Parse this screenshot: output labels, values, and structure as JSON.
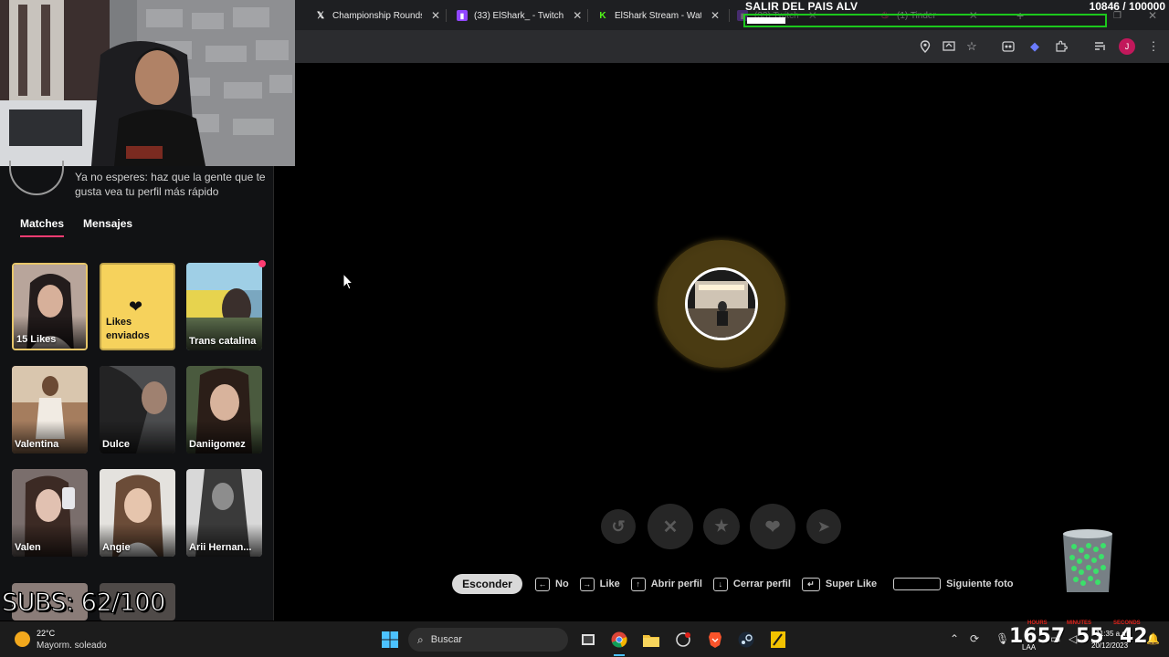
{
  "browser": {
    "tabs": [
      {
        "icon": "x-icon",
        "label": "Championship Rounds"
      },
      {
        "icon": "twitch-icon",
        "label": "(33) ElShark_ - Twitch"
      },
      {
        "icon": "kick-icon",
        "label": "ElShark Stream - Watch"
      },
      {
        "icon": "twitch-icon",
        "label": "(33) Twitch"
      },
      {
        "icon": "tinder-icon",
        "label": "(1) Tinder"
      }
    ]
  },
  "overlay": {
    "goal_title": "SALIR DEL PAIS ALV",
    "goal_counter": "10846 / 100000",
    "goal_progress": 0.108,
    "subs": "SUBS: 62/100"
  },
  "sidebar": {
    "boost_text": "Ya no esperes: haz que la gente que te gusta vea tu perfil más rápido",
    "tabs": [
      "Matches",
      "Mensajes"
    ],
    "active_tab": "Matches",
    "cards": [
      {
        "label": "15 Likes",
        "type": "likes"
      },
      {
        "label": "Likes enviados",
        "type": "sent"
      },
      {
        "label": "Trans catalina",
        "type": "match",
        "new": true
      },
      {
        "label": "Valentina",
        "type": "match"
      },
      {
        "label": "Dulce",
        "type": "match"
      },
      {
        "label": "Daniigomez",
        "type": "match"
      },
      {
        "label": "Valen",
        "type": "match"
      },
      {
        "label": "Angie",
        "type": "match"
      },
      {
        "label": "Arii Hernan...",
        "type": "match"
      }
    ]
  },
  "main": {
    "action_buttons": [
      "rewind",
      "nope",
      "super-like",
      "like",
      "boost"
    ],
    "hide_button": "Esconder",
    "shortcuts": [
      {
        "key": "←",
        "label": "No"
      },
      {
        "key": "→",
        "label": "Like"
      },
      {
        "key": "↑",
        "label": "Abrir perfil"
      },
      {
        "key": "↓",
        "label": "Cerrar perfil"
      },
      {
        "key": "↵",
        "label": "Super Like"
      },
      {
        "key": "space",
        "label": "Siguiente foto"
      }
    ]
  },
  "taskbar": {
    "weather_temp": "22°C",
    "weather_desc": "Mayorm. soleado",
    "search_placeholder": "Buscar",
    "clock_big_h": "1657",
    "clock_big_m": "55",
    "clock_big_s": "42",
    "timer_labels": [
      "HOURS",
      "MINUTES",
      "SECONDS"
    ],
    "time_small": "11:35 a.m.",
    "date_small": "20/12/2023",
    "lang": "LAA"
  }
}
